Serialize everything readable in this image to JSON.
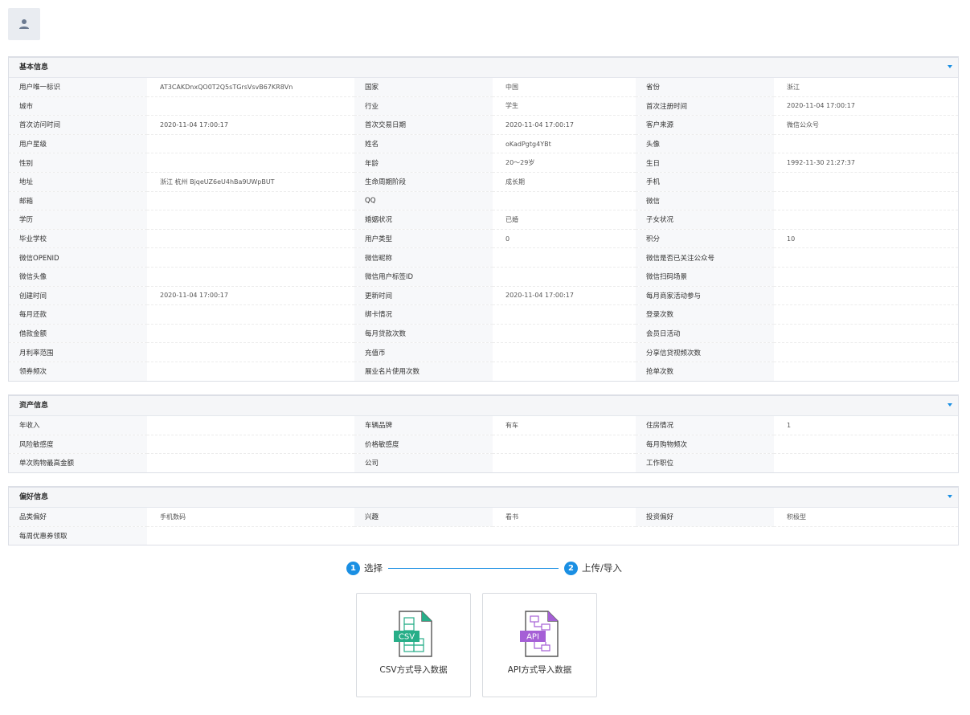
{
  "sections": [
    {
      "title": "基本信息",
      "rows": [
        [
          [
            "用户唯一标识",
            "AT3CAKDnxQO0T2Q5sTGrsVsvB67KR8Vn"
          ],
          [
            "国家",
            "中国"
          ],
          [
            "省份",
            "浙江"
          ]
        ],
        [
          [
            "城市",
            ""
          ],
          [
            "行业",
            "学生"
          ],
          [
            "首次注册时间",
            "2020-11-04 17:00:17"
          ]
        ],
        [
          [
            "首次访问时间",
            "2020-11-04 17:00:17"
          ],
          [
            "首次交易日期",
            "2020-11-04 17:00:17"
          ],
          [
            "客户来源",
            "微信公众号"
          ]
        ],
        [
          [
            "用户星级",
            ""
          ],
          [
            "姓名",
            "oKadPgtg4YBt"
          ],
          [
            "头像",
            ""
          ]
        ],
        [
          [
            "性别",
            ""
          ],
          [
            "年龄",
            "20～29岁"
          ],
          [
            "生日",
            "1992-11-30 21:27:37"
          ]
        ],
        [
          [
            "地址",
            "浙江 杭州 BjqeUZ6eU4hBa9UWpBUT"
          ],
          [
            "生命周期阶段",
            "成长期"
          ],
          [
            "手机",
            ""
          ]
        ],
        [
          [
            "邮箱",
            ""
          ],
          [
            "QQ",
            ""
          ],
          [
            "微信",
            ""
          ]
        ],
        [
          [
            "学历",
            ""
          ],
          [
            "婚姻状况",
            "已婚"
          ],
          [
            "子女状况",
            ""
          ]
        ],
        [
          [
            "毕业学校",
            ""
          ],
          [
            "用户类型",
            "0"
          ],
          [
            "积分",
            "10"
          ]
        ],
        [
          [
            "微信OPENID",
            ""
          ],
          [
            "微信昵称",
            ""
          ],
          [
            "微信是否已关注公众号",
            ""
          ]
        ],
        [
          [
            "微信头像",
            ""
          ],
          [
            "微信用户标签ID",
            ""
          ],
          [
            "微信扫码场景",
            ""
          ]
        ],
        [
          [
            "创建时间",
            "2020-11-04 17:00:17"
          ],
          [
            "更新时间",
            "2020-11-04 17:00:17"
          ],
          [
            "每月商家活动参与",
            ""
          ]
        ],
        [
          [
            "每月还款",
            ""
          ],
          [
            "绑卡情况",
            ""
          ],
          [
            "登录次数",
            ""
          ]
        ],
        [
          [
            "借款金额",
            ""
          ],
          [
            "每月贷款次数",
            ""
          ],
          [
            "会员日活动",
            ""
          ]
        ],
        [
          [
            "月利率范围",
            ""
          ],
          [
            "充值币",
            ""
          ],
          [
            "分享信贷视频次数",
            ""
          ]
        ],
        [
          [
            "领券频次",
            ""
          ],
          [
            "展业名片使用次数",
            ""
          ],
          [
            "抢单次数",
            ""
          ]
        ]
      ]
    },
    {
      "title": "资产信息",
      "rows": [
        [
          [
            "年收入",
            ""
          ],
          [
            "车辆品牌",
            "有车"
          ],
          [
            "住房情况",
            "1"
          ]
        ],
        [
          [
            "风险敏感度",
            ""
          ],
          [
            "价格敏感度",
            ""
          ],
          [
            "每月购物频次",
            ""
          ]
        ],
        [
          [
            "单次购物最高金额",
            ""
          ],
          [
            "公司",
            ""
          ],
          [
            "工作职位",
            ""
          ]
        ]
      ]
    },
    {
      "title": "偏好信息",
      "rows": [
        [
          [
            "品类偏好",
            "手机数码"
          ],
          [
            "兴趣",
            "看书"
          ],
          [
            "投资偏好",
            "积极型"
          ]
        ],
        [
          [
            "每周优惠券领取",
            ""
          ]
        ]
      ]
    }
  ],
  "steps": [
    {
      "num": "1",
      "label": "选择"
    },
    {
      "num": "2",
      "label": "上传/导入"
    }
  ],
  "cards": [
    {
      "icon_text": "CSV",
      "label": "CSV方式导入数据"
    },
    {
      "icon_text": "API",
      "label": "API方式导入数据"
    }
  ],
  "colors": {
    "accent": "#1a8fe3",
    "csv": "#27ae88",
    "api": "#a55fd6"
  }
}
